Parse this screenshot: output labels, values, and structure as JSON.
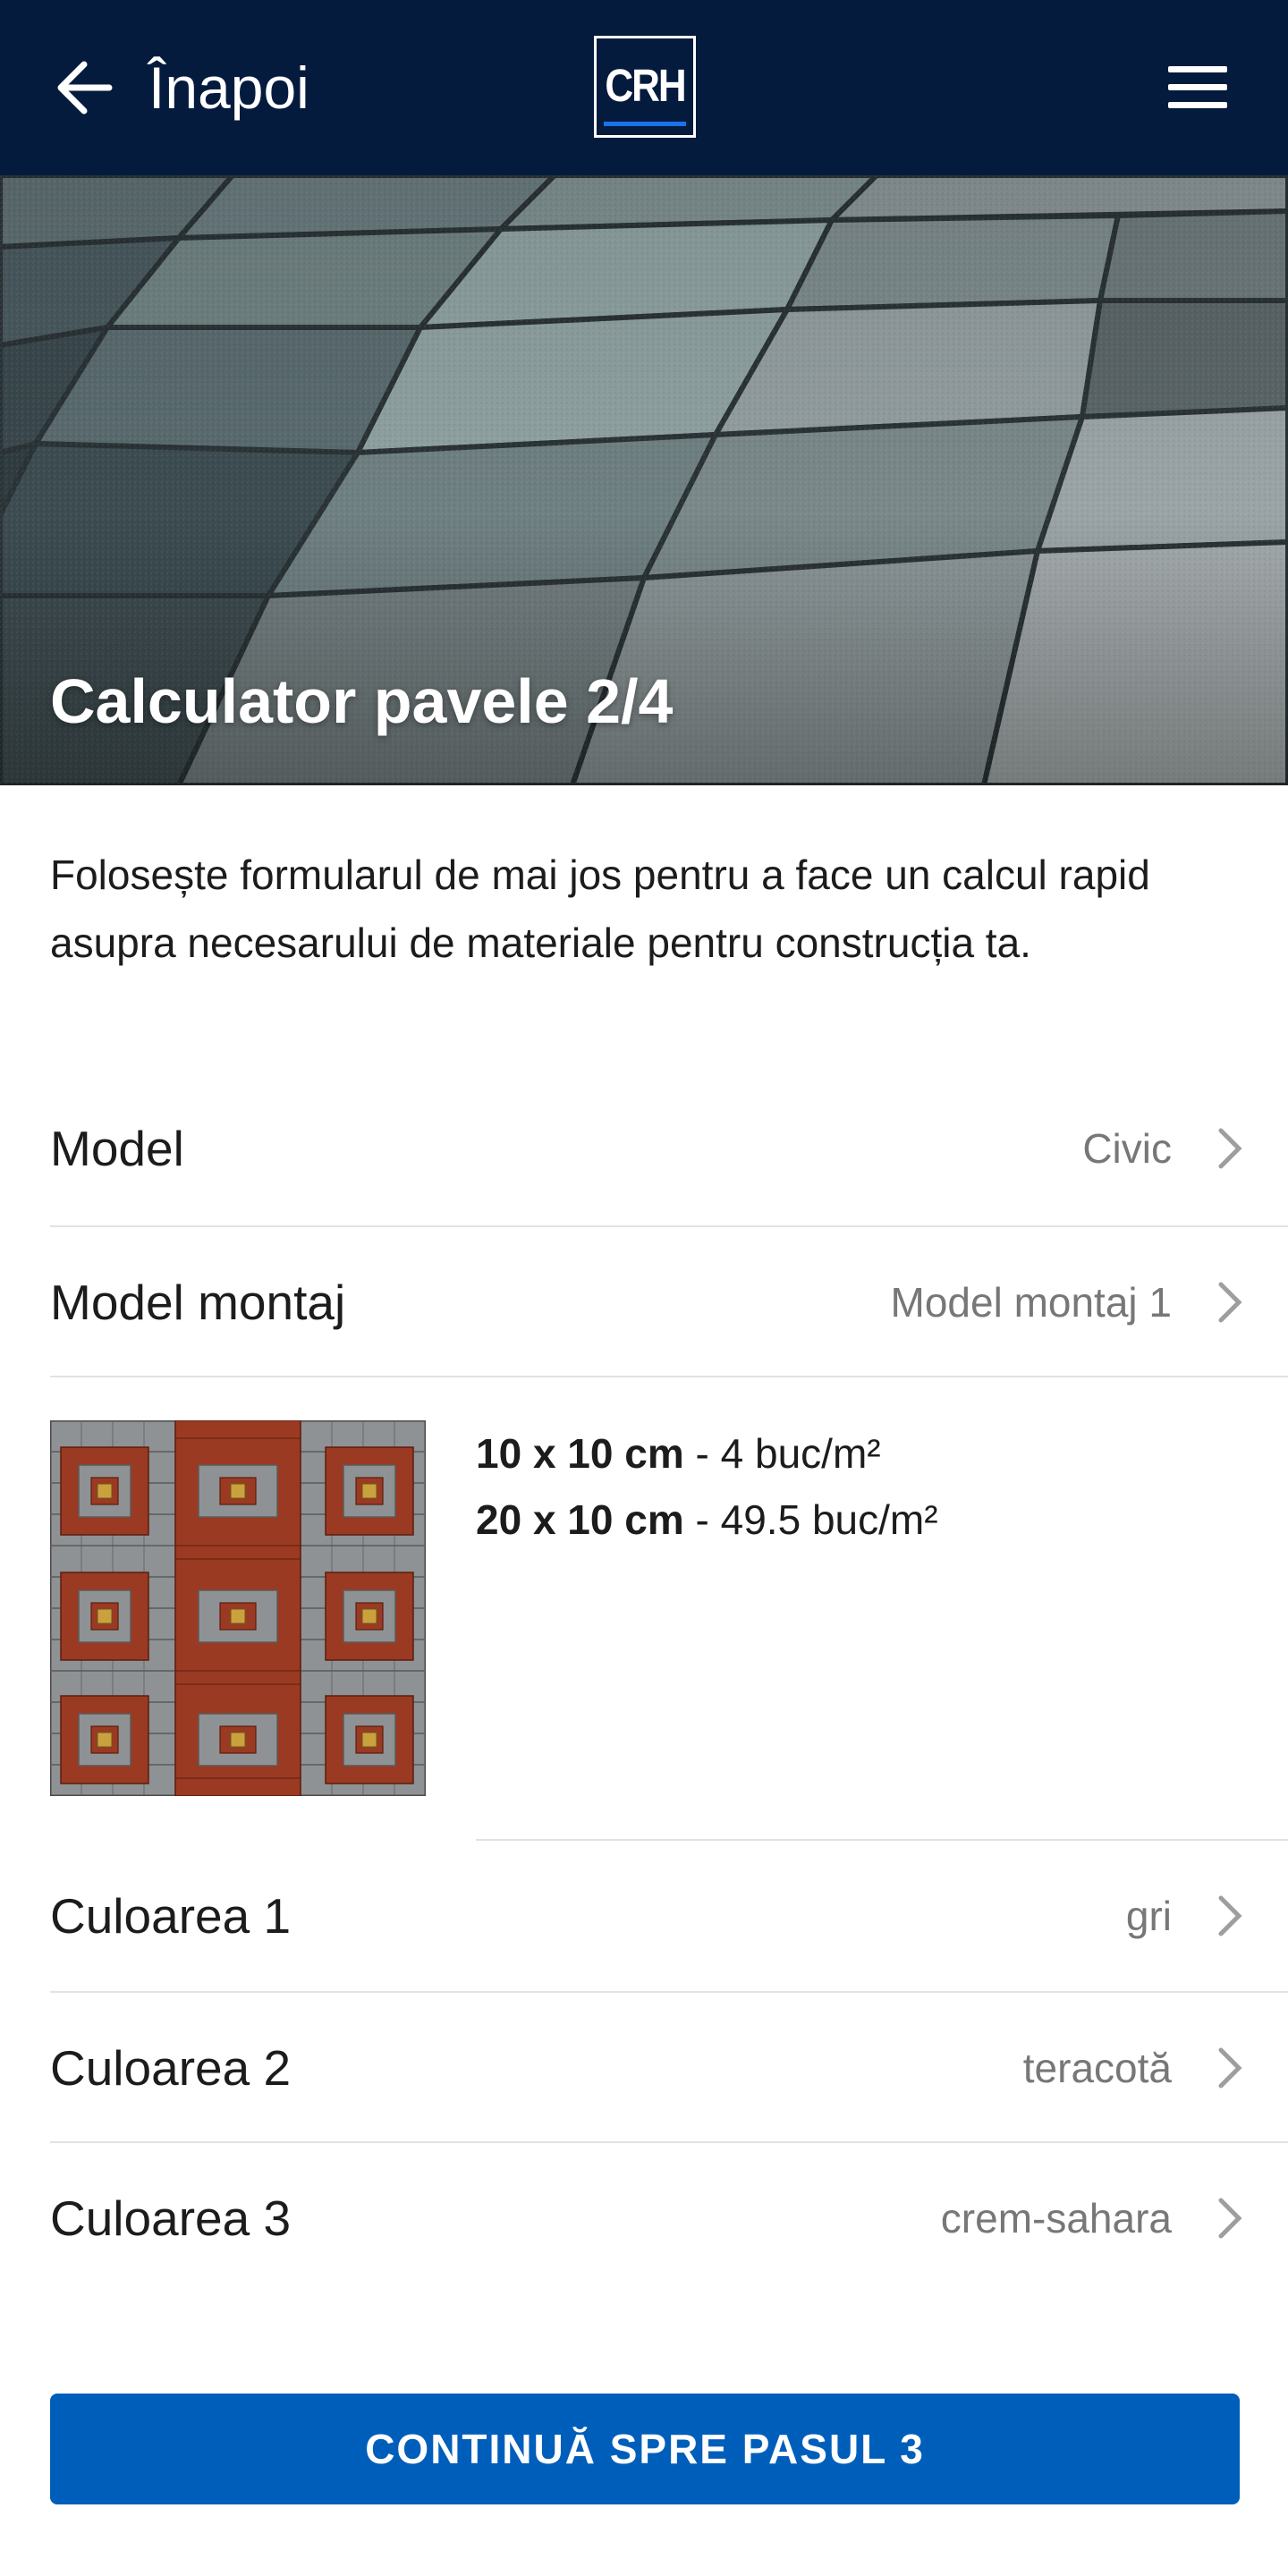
{
  "header": {
    "back_label": "Înapoi",
    "logo_text": "CRH",
    "back_icon": "arrow-left-icon",
    "menu_icon": "hamburger-menu-icon"
  },
  "hero": {
    "title": "Calculator pavele 2/4"
  },
  "intro_text": "Folosește formularul de mai jos pentru a face un calcul rapid asupra necesarului de materiale pentru construcția ta.",
  "fields": {
    "model": {
      "label": "Model",
      "value": "Civic"
    },
    "model_montaj": {
      "label": "Model montaj",
      "value": "Model montaj 1"
    },
    "color1": {
      "label": "Culoarea 1",
      "value": "gri"
    },
    "color2": {
      "label": "Culoarea 2",
      "value": "teracotă"
    },
    "color3": {
      "label": "Culoarea 3",
      "value": "crem-sahara"
    }
  },
  "specs": [
    {
      "size": "10 x 10 cm",
      "qty": " - 4 buc/m²"
    },
    {
      "size": "20 x 10 cm",
      "qty": " - 49.5 buc/m²"
    }
  ],
  "pattern_colors": {
    "gri": "#8f9294",
    "teracota": "#9b3a22",
    "crem_sahara": "#c9a23e"
  },
  "cta_label": "CONTINUĂ SPRE PASUL 3",
  "colors": {
    "header_bg": "#041b3e",
    "accent": "#005ebb"
  }
}
